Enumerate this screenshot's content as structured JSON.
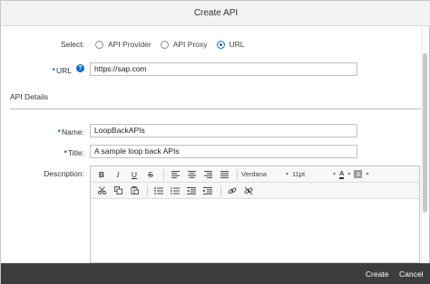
{
  "dialog": {
    "title": "Create API"
  },
  "select": {
    "label": "Select:",
    "options": [
      "API Provider",
      "API Proxy",
      "URL"
    ],
    "selected": "URL"
  },
  "url": {
    "required_mark": "*",
    "label": "URL",
    "value": "https://sap.com",
    "help_icon": "?"
  },
  "section": {
    "title": "API Details"
  },
  "name": {
    "required_mark": "*",
    "label": "Name:",
    "value": "LoopBackAPIs"
  },
  "title_field": {
    "required_mark": "*",
    "label": "Title:",
    "value": "A  sample loop back APIs"
  },
  "description": {
    "label": "Description:",
    "font_family": "Verdana",
    "font_size": "11pt",
    "bold_label": "B",
    "italic_label": "I",
    "underline_label": "U",
    "strike_label": "S",
    "font_color_label": "A",
    "highlight_label": "A",
    "caret": "▾"
  },
  "footer": {
    "create_label": "Create",
    "cancel_label": "Cancel"
  },
  "colors": {
    "accent": "#0a6ed1",
    "footer_bg": "#3d3d3d",
    "header_bg": "#f2f2f2"
  }
}
